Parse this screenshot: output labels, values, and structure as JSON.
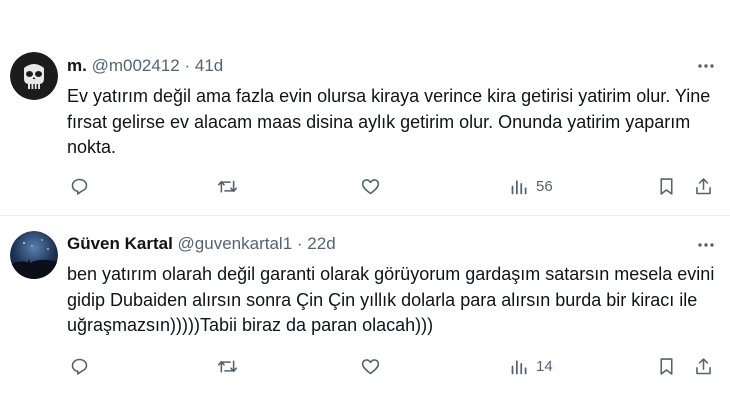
{
  "tweets": [
    {
      "display_name": "m.",
      "handle": "@m002412",
      "separator": "·",
      "time": "41d",
      "text": "Ev yatırım değil ama fazla evin olursa kiraya verince kira getirisi yatirim olur. Yine fırsat gelirse ev alacam maas disina aylık getirim olur. Onunda yatirim yaparım nokta.",
      "views": "56",
      "avatar_icon": "skull-emblem-avatar"
    },
    {
      "display_name": "Güven Kartal",
      "handle": "@guvenkartal1",
      "separator": "·",
      "time": "22d",
      "text": "ben yatırım olarah değil garanti olarak görüyorum gardaşım satarsın mesela evini gidip Dubaiden alırsın sonra Çin Çin yıllık dolarla para alırsın burda bir kiracı ile uğraşmazsın)))))Tabii biraz da paran olacah)))",
      "views": "14",
      "avatar_icon": "night-sky-avatar"
    }
  ],
  "colors": {
    "text": "#0f1419",
    "secondary": "#536471",
    "divider": "#e6ecf0"
  }
}
